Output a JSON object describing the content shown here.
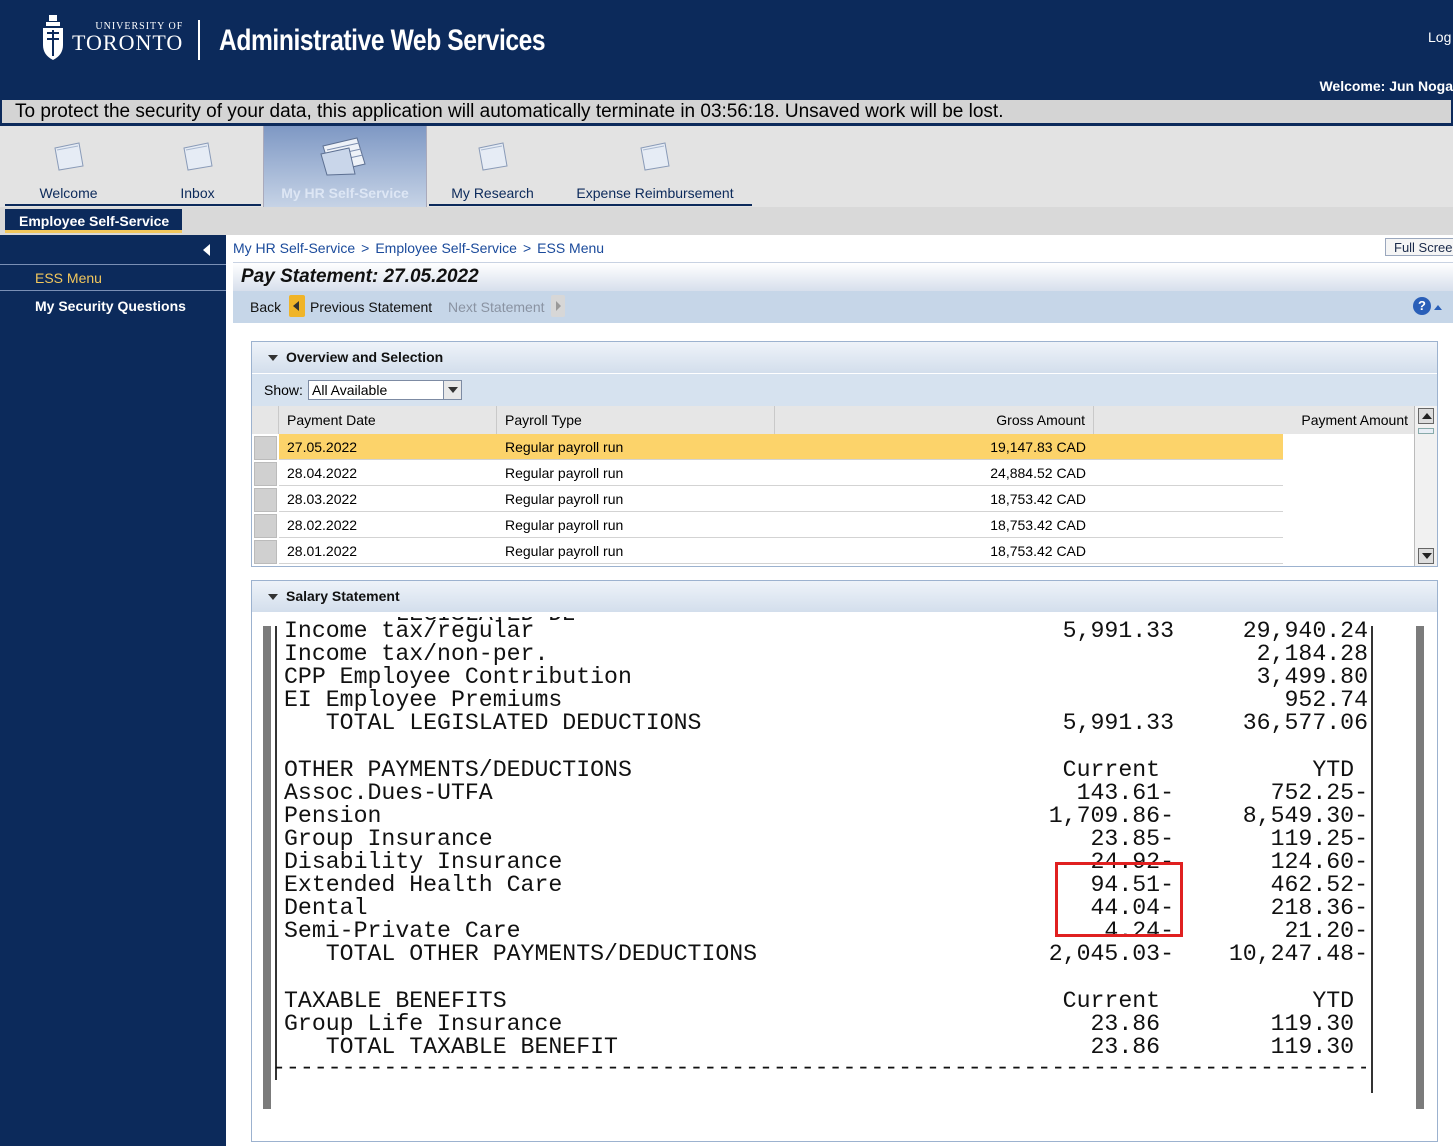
{
  "header": {
    "university_small": "UNIVERSITY OF",
    "university_big": "TORONTO",
    "app_title": "Administrative Web Services",
    "logout": "Log",
    "welcome_label": "Welcome:",
    "welcome_user": "Jun Noga"
  },
  "timeout_message": "To protect the security of your data, this application will automatically terminate in 03:56:18. Unsaved work will be lost.",
  "tabs": [
    {
      "label": "Welcome"
    },
    {
      "label": "Inbox"
    },
    {
      "label": "My HR Self-Service"
    },
    {
      "label": "My Research"
    },
    {
      "label": "Expense Reimbursement"
    }
  ],
  "subnav": {
    "active": "Employee Self-Service"
  },
  "sidebar": {
    "items": [
      {
        "label": "ESS Menu"
      },
      {
        "label": "My Security Questions"
      }
    ]
  },
  "breadcrumb": [
    "My HR Self-Service",
    "Employee Self-Service",
    "ESS Menu"
  ],
  "breadcrumb_sep": ">",
  "fullscreen": "Full Scree",
  "page_title": "Pay Statement: 27.05.2022",
  "toolbar": {
    "back": "Back",
    "previous": "Previous Statement",
    "next": "Next Statement",
    "help": "?"
  },
  "overview": {
    "title": "Overview and Selection",
    "show_label": "Show:",
    "show_value": "All Available",
    "columns": [
      "Payment Date",
      "Payroll Type",
      "Gross Amount",
      "Payment Amount"
    ],
    "rows": [
      {
        "date": "27.05.2022",
        "type": "Regular payroll run",
        "gross": "19,147.83 CAD"
      },
      {
        "date": "28.04.2022",
        "type": "Regular payroll run",
        "gross": "24,884.52 CAD"
      },
      {
        "date": "28.03.2022",
        "type": "Regular payroll run",
        "gross": "18,753.42 CAD"
      },
      {
        "date": "28.02.2022",
        "type": "Regular payroll run",
        "gross": "18,753.42 CAD"
      },
      {
        "date": "28.01.2022",
        "type": "Regular payroll run",
        "gross": "18,753.42 CAD"
      }
    ]
  },
  "salary": {
    "title": "Salary Statement",
    "cut_heading": "LEGISLATED DEDUCTIONS",
    "lines": [
      {
        "label": "Income tax/regular",
        "current": "5,991.33",
        "ytd": "29,940.24"
      },
      {
        "label": "Income tax/non-per.",
        "current": "",
        "ytd": "2,184.28"
      },
      {
        "label": "CPP Employee Contribution",
        "current": "",
        "ytd": "3,499.80"
      },
      {
        "label": "EI Employee Premiums",
        "current": "",
        "ytd": "952.74"
      },
      {
        "label": "   TOTAL LEGISLATED DEDUCTIONS",
        "current": "5,991.33",
        "ytd": "36,577.06"
      },
      {
        "label": "",
        "current": "",
        "ytd": ""
      },
      {
        "label": "OTHER PAYMENTS/DEDUCTIONS",
        "current": "Current ",
        "ytd": "YTD "
      },
      {
        "label": "Assoc.Dues-UTFA",
        "current": "143.61-",
        "ytd": "752.25-"
      },
      {
        "label": "Pension",
        "current": "1,709.86-",
        "ytd": "8,549.30-"
      },
      {
        "label": "Group Insurance",
        "current": "23.85-",
        "ytd": "119.25-"
      },
      {
        "label": "Disability Insurance",
        "current": "24.92-",
        "ytd": "124.60-"
      },
      {
        "label": "Extended Health Care",
        "current": "94.51-",
        "ytd": "462.52-"
      },
      {
        "label": "Dental",
        "current": "44.04-",
        "ytd": "218.36-"
      },
      {
        "label": "Semi-Private Care",
        "current": "4.24-",
        "ytd": "21.20-"
      },
      {
        "label": "   TOTAL OTHER PAYMENTS/DEDUCTIONS",
        "current": "2,045.03-",
        "ytd": "10,247.48-"
      },
      {
        "label": "",
        "current": "",
        "ytd": ""
      },
      {
        "label": "TAXABLE BENEFITS",
        "current": "Current ",
        "ytd": "YTD "
      },
      {
        "label": "Group Life Insurance",
        "current": "23.86 ",
        "ytd": "119.30 "
      },
      {
        "label": "   TOTAL TAXABLE BENEFIT",
        "current": "23.86 ",
        "ytd": "119.30 "
      }
    ],
    "separator": "------------------------------------------------------------------------------------------------------------"
  },
  "colors": {
    "navy": "#0c2a5b",
    "gold": "#f2c75c",
    "selected_row": "#fcd36a",
    "highlight": "#e02020"
  }
}
